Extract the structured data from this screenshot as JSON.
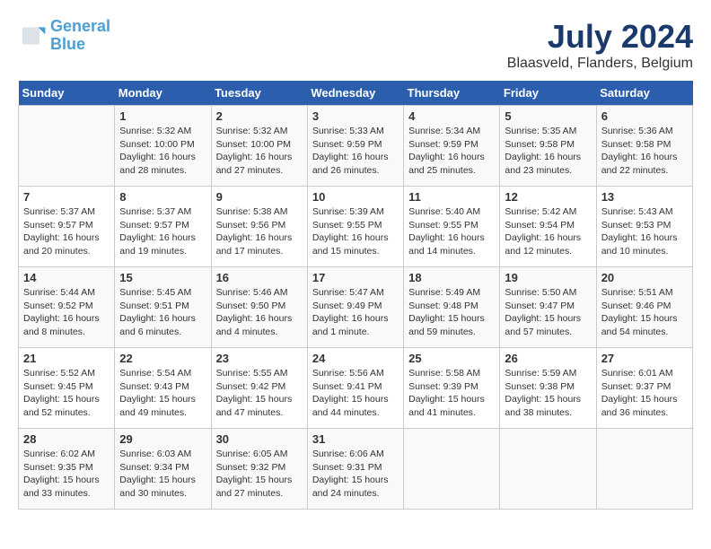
{
  "header": {
    "logo_line1": "General",
    "logo_line2": "Blue",
    "month_year": "July 2024",
    "location": "Blaasveld, Flanders, Belgium"
  },
  "columns": [
    "Sunday",
    "Monday",
    "Tuesday",
    "Wednesday",
    "Thursday",
    "Friday",
    "Saturday"
  ],
  "weeks": [
    [
      {
        "day": "",
        "info": ""
      },
      {
        "day": "1",
        "info": "Sunrise: 5:32 AM\nSunset: 10:00 PM\nDaylight: 16 hours\nand 28 minutes."
      },
      {
        "day": "2",
        "info": "Sunrise: 5:32 AM\nSunset: 10:00 PM\nDaylight: 16 hours\nand 27 minutes."
      },
      {
        "day": "3",
        "info": "Sunrise: 5:33 AM\nSunset: 9:59 PM\nDaylight: 16 hours\nand 26 minutes."
      },
      {
        "day": "4",
        "info": "Sunrise: 5:34 AM\nSunset: 9:59 PM\nDaylight: 16 hours\nand 25 minutes."
      },
      {
        "day": "5",
        "info": "Sunrise: 5:35 AM\nSunset: 9:58 PM\nDaylight: 16 hours\nand 23 minutes."
      },
      {
        "day": "6",
        "info": "Sunrise: 5:36 AM\nSunset: 9:58 PM\nDaylight: 16 hours\nand 22 minutes."
      }
    ],
    [
      {
        "day": "7",
        "info": "Sunrise: 5:37 AM\nSunset: 9:57 PM\nDaylight: 16 hours\nand 20 minutes."
      },
      {
        "day": "8",
        "info": "Sunrise: 5:37 AM\nSunset: 9:57 PM\nDaylight: 16 hours\nand 19 minutes."
      },
      {
        "day": "9",
        "info": "Sunrise: 5:38 AM\nSunset: 9:56 PM\nDaylight: 16 hours\nand 17 minutes."
      },
      {
        "day": "10",
        "info": "Sunrise: 5:39 AM\nSunset: 9:55 PM\nDaylight: 16 hours\nand 15 minutes."
      },
      {
        "day": "11",
        "info": "Sunrise: 5:40 AM\nSunset: 9:55 PM\nDaylight: 16 hours\nand 14 minutes."
      },
      {
        "day": "12",
        "info": "Sunrise: 5:42 AM\nSunset: 9:54 PM\nDaylight: 16 hours\nand 12 minutes."
      },
      {
        "day": "13",
        "info": "Sunrise: 5:43 AM\nSunset: 9:53 PM\nDaylight: 16 hours\nand 10 minutes."
      }
    ],
    [
      {
        "day": "14",
        "info": "Sunrise: 5:44 AM\nSunset: 9:52 PM\nDaylight: 16 hours\nand 8 minutes."
      },
      {
        "day": "15",
        "info": "Sunrise: 5:45 AM\nSunset: 9:51 PM\nDaylight: 16 hours\nand 6 minutes."
      },
      {
        "day": "16",
        "info": "Sunrise: 5:46 AM\nSunset: 9:50 PM\nDaylight: 16 hours\nand 4 minutes."
      },
      {
        "day": "17",
        "info": "Sunrise: 5:47 AM\nSunset: 9:49 PM\nDaylight: 16 hours\nand 1 minute."
      },
      {
        "day": "18",
        "info": "Sunrise: 5:49 AM\nSunset: 9:48 PM\nDaylight: 15 hours\nand 59 minutes."
      },
      {
        "day": "19",
        "info": "Sunrise: 5:50 AM\nSunset: 9:47 PM\nDaylight: 15 hours\nand 57 minutes."
      },
      {
        "day": "20",
        "info": "Sunrise: 5:51 AM\nSunset: 9:46 PM\nDaylight: 15 hours\nand 54 minutes."
      }
    ],
    [
      {
        "day": "21",
        "info": "Sunrise: 5:52 AM\nSunset: 9:45 PM\nDaylight: 15 hours\nand 52 minutes."
      },
      {
        "day": "22",
        "info": "Sunrise: 5:54 AM\nSunset: 9:43 PM\nDaylight: 15 hours\nand 49 minutes."
      },
      {
        "day": "23",
        "info": "Sunrise: 5:55 AM\nSunset: 9:42 PM\nDaylight: 15 hours\nand 47 minutes."
      },
      {
        "day": "24",
        "info": "Sunrise: 5:56 AM\nSunset: 9:41 PM\nDaylight: 15 hours\nand 44 minutes."
      },
      {
        "day": "25",
        "info": "Sunrise: 5:58 AM\nSunset: 9:39 PM\nDaylight: 15 hours\nand 41 minutes."
      },
      {
        "day": "26",
        "info": "Sunrise: 5:59 AM\nSunset: 9:38 PM\nDaylight: 15 hours\nand 38 minutes."
      },
      {
        "day": "27",
        "info": "Sunrise: 6:01 AM\nSunset: 9:37 PM\nDaylight: 15 hours\nand 36 minutes."
      }
    ],
    [
      {
        "day": "28",
        "info": "Sunrise: 6:02 AM\nSunset: 9:35 PM\nDaylight: 15 hours\nand 33 minutes."
      },
      {
        "day": "29",
        "info": "Sunrise: 6:03 AM\nSunset: 9:34 PM\nDaylight: 15 hours\nand 30 minutes."
      },
      {
        "day": "30",
        "info": "Sunrise: 6:05 AM\nSunset: 9:32 PM\nDaylight: 15 hours\nand 27 minutes."
      },
      {
        "day": "31",
        "info": "Sunrise: 6:06 AM\nSunset: 9:31 PM\nDaylight: 15 hours\nand 24 minutes."
      },
      {
        "day": "",
        "info": ""
      },
      {
        "day": "",
        "info": ""
      },
      {
        "day": "",
        "info": ""
      }
    ]
  ]
}
